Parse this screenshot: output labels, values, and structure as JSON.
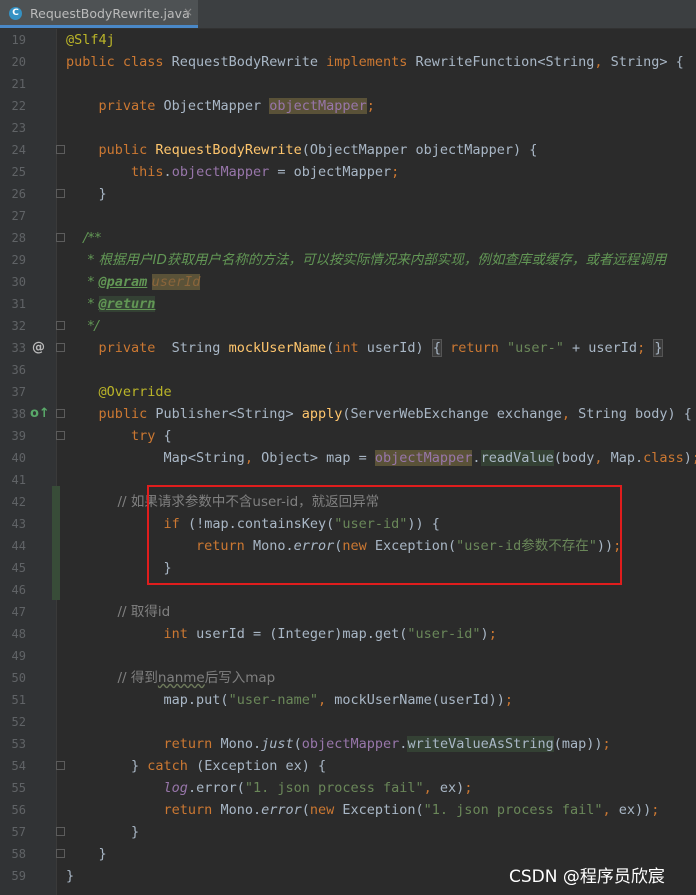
{
  "tab": {
    "label": "RequestBodyRewrite.java",
    "icon_letter": "C",
    "close": "×"
  },
  "watermark": "CSDN @程序员欣宸",
  "lines": [
    {
      "n": "19",
      "spans": [
        {
          "c": "t-ann",
          "t": "@Slf4j"
        }
      ]
    },
    {
      "n": "20",
      "spans": [
        {
          "c": "t-kw",
          "t": "public class "
        },
        {
          "c": "",
          "t": "RequestBodyRewrite "
        },
        {
          "c": "t-kw",
          "t": "implements "
        },
        {
          "c": "",
          "t": "RewriteFunction<String"
        },
        {
          "c": "t-kw",
          "t": ", "
        },
        {
          "c": "",
          "t": "String> {"
        }
      ]
    },
    {
      "n": "21",
      "spans": []
    },
    {
      "n": "22",
      "spans": [
        {
          "c": "",
          "t": "    "
        },
        {
          "c": "t-kw",
          "t": "private "
        },
        {
          "c": "",
          "t": "ObjectMapper "
        },
        {
          "c": "t-field hl-warn",
          "t": "objectMapper"
        },
        {
          "c": "t-kw",
          "t": ";"
        }
      ]
    },
    {
      "n": "23",
      "spans": []
    },
    {
      "n": "24",
      "spans": [
        {
          "c": "",
          "t": "    "
        },
        {
          "c": "t-kw",
          "t": "public "
        },
        {
          "c": "t-fn",
          "t": "RequestBodyRewrite"
        },
        {
          "c": "",
          "t": "(ObjectMapper objectMapper) {"
        }
      ]
    },
    {
      "n": "25",
      "spans": [
        {
          "c": "",
          "t": "        "
        },
        {
          "c": "t-kw",
          "t": "this"
        },
        {
          "c": "",
          "t": "."
        },
        {
          "c": "t-field",
          "t": "objectMapper"
        },
        {
          "c": "",
          "t": " = objectMapper"
        },
        {
          "c": "t-kw",
          "t": ";"
        }
      ]
    },
    {
      "n": "26",
      "spans": [
        {
          "c": "",
          "t": "    }"
        }
      ]
    },
    {
      "n": "27",
      "spans": []
    },
    {
      "n": "28",
      "spans": [
        {
          "c": "t-doc",
          "t": "    /**"
        }
      ]
    },
    {
      "n": "29",
      "spans": [
        {
          "c": "t-doc",
          "t": "     * 根据用户ID获取用户名称的方法，可以按实际情况来内部实现，例如查库或缓存，或者远程调用"
        }
      ]
    },
    {
      "n": "30",
      "spans": [
        {
          "c": "t-doc",
          "t": "     * "
        },
        {
          "c": "t-doctag",
          "t": "@param"
        },
        {
          "c": "t-doc",
          "t": " "
        },
        {
          "c": "t-docparam hl-warn",
          "t": "userId"
        }
      ]
    },
    {
      "n": "31",
      "spans": [
        {
          "c": "t-doc",
          "t": "     * "
        },
        {
          "c": "t-doctag hl-ref",
          "t": "@return"
        }
      ]
    },
    {
      "n": "32",
      "spans": [
        {
          "c": "t-doc",
          "t": "     */"
        }
      ]
    },
    {
      "n": "33",
      "spans": [
        {
          "c": "",
          "t": "    "
        },
        {
          "c": "t-kw",
          "t": "private  "
        },
        {
          "c": "",
          "t": "String "
        },
        {
          "c": "t-fn",
          "t": "mockUserName"
        },
        {
          "c": "",
          "t": "("
        },
        {
          "c": "t-kw",
          "t": "int "
        },
        {
          "c": "",
          "t": "userId) "
        },
        {
          "c": "hl-brace",
          "t": "{"
        },
        {
          "c": "",
          "t": " "
        },
        {
          "c": "t-kw",
          "t": "return "
        },
        {
          "c": "t-str",
          "t": "\"user-\""
        },
        {
          "c": "",
          "t": " + userId"
        },
        {
          "c": "t-kw",
          "t": ";"
        },
        {
          "c": "",
          "t": " "
        },
        {
          "c": "hl-brace",
          "t": "}"
        }
      ]
    },
    {
      "n": "36",
      "spans": []
    },
    {
      "n": "37",
      "spans": [
        {
          "c": "",
          "t": "    "
        },
        {
          "c": "t-ann",
          "t": "@Override"
        }
      ]
    },
    {
      "n": "38",
      "spans": [
        {
          "c": "",
          "t": "    "
        },
        {
          "c": "t-kw",
          "t": "public "
        },
        {
          "c": "",
          "t": "Publisher<String> "
        },
        {
          "c": "t-fn",
          "t": "apply"
        },
        {
          "c": "",
          "t": "(ServerWebExchange exchange"
        },
        {
          "c": "t-kw",
          "t": ", "
        },
        {
          "c": "",
          "t": "String body) {"
        }
      ]
    },
    {
      "n": "39",
      "spans": [
        {
          "c": "",
          "t": "        "
        },
        {
          "c": "t-kw",
          "t": "try "
        },
        {
          "c": "",
          "t": "{"
        }
      ]
    },
    {
      "n": "40",
      "spans": [
        {
          "c": "",
          "t": "            Map<String"
        },
        {
          "c": "t-kw",
          "t": ", "
        },
        {
          "c": "",
          "t": "Object> map = "
        },
        {
          "c": "t-field hl-warn",
          "t": "objectMapper"
        },
        {
          "c": "",
          "t": "."
        },
        {
          "c": "hl-ref",
          "t": "readValue"
        },
        {
          "c": "",
          "t": "(body"
        },
        {
          "c": "t-kw",
          "t": ", "
        },
        {
          "c": "",
          "t": "Map."
        },
        {
          "c": "t-kw",
          "t": "class"
        },
        {
          "c": "",
          "t": ")"
        },
        {
          "c": "t-kw",
          "t": ";"
        }
      ]
    },
    {
      "n": "41",
      "spans": []
    },
    {
      "n": "42",
      "spans": [
        {
          "c": "t-cmt",
          "t": "            // 如果请求参数中不含user-id，就返回异常"
        }
      ]
    },
    {
      "n": "43",
      "spans": [
        {
          "c": "",
          "t": "            "
        },
        {
          "c": "t-kw",
          "t": "if "
        },
        {
          "c": "",
          "t": "(!map.containsKey("
        },
        {
          "c": "t-str",
          "t": "\"user-id\""
        },
        {
          "c": "",
          "t": ")) {"
        }
      ]
    },
    {
      "n": "44",
      "spans": [
        {
          "c": "",
          "t": "                "
        },
        {
          "c": "t-kw",
          "t": "return "
        },
        {
          "c": "",
          "t": "Mono."
        },
        {
          "c": "t-italic",
          "t": "error"
        },
        {
          "c": "",
          "t": "("
        },
        {
          "c": "t-kw",
          "t": "new "
        },
        {
          "c": "",
          "t": "Exception("
        },
        {
          "c": "t-str",
          "t": "\"user-id参数不存在\""
        },
        {
          "c": "",
          "t": "))"
        },
        {
          "c": "t-kw",
          "t": ";"
        }
      ]
    },
    {
      "n": "45",
      "spans": [
        {
          "c": "",
          "t": "            }"
        }
      ]
    },
    {
      "n": "46",
      "spans": []
    },
    {
      "n": "47",
      "spans": [
        {
          "c": "t-cmt",
          "t": "            // 取得id"
        }
      ]
    },
    {
      "n": "48",
      "spans": [
        {
          "c": "",
          "t": "            "
        },
        {
          "c": "t-kw",
          "t": "int "
        },
        {
          "c": "",
          "t": "userId = (Integer)map.get("
        },
        {
          "c": "t-str",
          "t": "\"user-id\""
        },
        {
          "c": "",
          "t": ")"
        },
        {
          "c": "t-kw",
          "t": ";"
        }
      ]
    },
    {
      "n": "49",
      "spans": []
    },
    {
      "n": "50",
      "spans": [
        {
          "c": "t-cmt",
          "t": "            // 得到"
        },
        {
          "c": "t-cmt squiggle",
          "t": "nanme"
        },
        {
          "c": "t-cmt",
          "t": "后写入map"
        }
      ]
    },
    {
      "n": "51",
      "spans": [
        {
          "c": "",
          "t": "            map.put("
        },
        {
          "c": "t-str",
          "t": "\"user-name\""
        },
        {
          "c": "t-kw",
          "t": ", "
        },
        {
          "c": "",
          "t": "mockUserName(userId))"
        },
        {
          "c": "t-kw",
          "t": ";"
        }
      ]
    },
    {
      "n": "52",
      "spans": []
    },
    {
      "n": "53",
      "spans": [
        {
          "c": "",
          "t": "            "
        },
        {
          "c": "t-kw",
          "t": "return "
        },
        {
          "c": "",
          "t": "Mono."
        },
        {
          "c": "t-italic",
          "t": "just"
        },
        {
          "c": "",
          "t": "("
        },
        {
          "c": "t-field",
          "t": "objectMapper"
        },
        {
          "c": "",
          "t": "."
        },
        {
          "c": "hl-ref",
          "t": "writeValueAsString"
        },
        {
          "c": "",
          "t": "(map))"
        },
        {
          "c": "t-kw",
          "t": ";"
        }
      ]
    },
    {
      "n": "54",
      "spans": [
        {
          "c": "",
          "t": "        } "
        },
        {
          "c": "t-kw",
          "t": "catch "
        },
        {
          "c": "",
          "t": "(Exception ex) {"
        }
      ]
    },
    {
      "n": "55",
      "spans": [
        {
          "c": "",
          "t": "            "
        },
        {
          "c": "t-static",
          "t": "log"
        },
        {
          "c": "",
          "t": ".error("
        },
        {
          "c": "t-str",
          "t": "\"1. json process fail\""
        },
        {
          "c": "t-kw",
          "t": ", "
        },
        {
          "c": "",
          "t": "ex)"
        },
        {
          "c": "t-kw",
          "t": ";"
        }
      ]
    },
    {
      "n": "56",
      "spans": [
        {
          "c": "",
          "t": "            "
        },
        {
          "c": "t-kw",
          "t": "return "
        },
        {
          "c": "",
          "t": "Mono."
        },
        {
          "c": "t-italic",
          "t": "error"
        },
        {
          "c": "",
          "t": "("
        },
        {
          "c": "t-kw",
          "t": "new "
        },
        {
          "c": "",
          "t": "Exception("
        },
        {
          "c": "t-str",
          "t": "\"1. json process fail\""
        },
        {
          "c": "t-kw",
          "t": ", "
        },
        {
          "c": "",
          "t": "ex))"
        },
        {
          "c": "t-kw",
          "t": ";"
        }
      ]
    },
    {
      "n": "57",
      "spans": [
        {
          "c": "",
          "t": "        }"
        }
      ]
    },
    {
      "n": "58",
      "spans": [
        {
          "c": "",
          "t": "    }"
        }
      ]
    },
    {
      "n": "59",
      "spans": [
        {
          "c": "",
          "t": "}"
        }
      ]
    }
  ],
  "gutter_markers": [
    {
      "line": "33",
      "icon": "at-implementation-icon",
      "glyph": "@"
    },
    {
      "line": "38",
      "icon": "override-method-icon",
      "glyph": "o↑"
    }
  ],
  "fold_lines": [
    "24",
    "26",
    "28",
    "32",
    "33",
    "38",
    "39",
    "54",
    "57",
    "58"
  ],
  "colors": {
    "background": "#2b2b2b",
    "keyword": "#cc7832",
    "string": "#6a8759",
    "highlight_box": "#e01d1d"
  }
}
